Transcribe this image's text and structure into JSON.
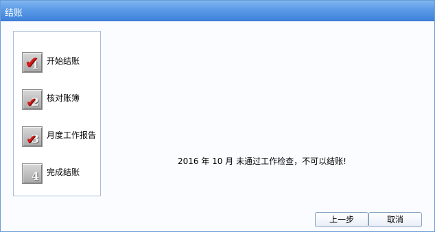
{
  "window": {
    "title": "结账"
  },
  "steps": [
    {
      "number": "1",
      "label": "开始结账",
      "status": "done"
    },
    {
      "number": "2",
      "label": "核对账簿",
      "status": "done"
    },
    {
      "number": "3",
      "label": "月度工作报告",
      "status": "done"
    },
    {
      "number": "4",
      "label": "完成结账",
      "status": "pending"
    }
  ],
  "message": "2016 年 10 月 未通过工作检查，不可以结账!",
  "buttons": {
    "prev": "上一步",
    "cancel": "取消"
  },
  "colors": {
    "titlebar": "#4f8fe0",
    "check": "#d61a1a",
    "border": "#a9bed6"
  }
}
